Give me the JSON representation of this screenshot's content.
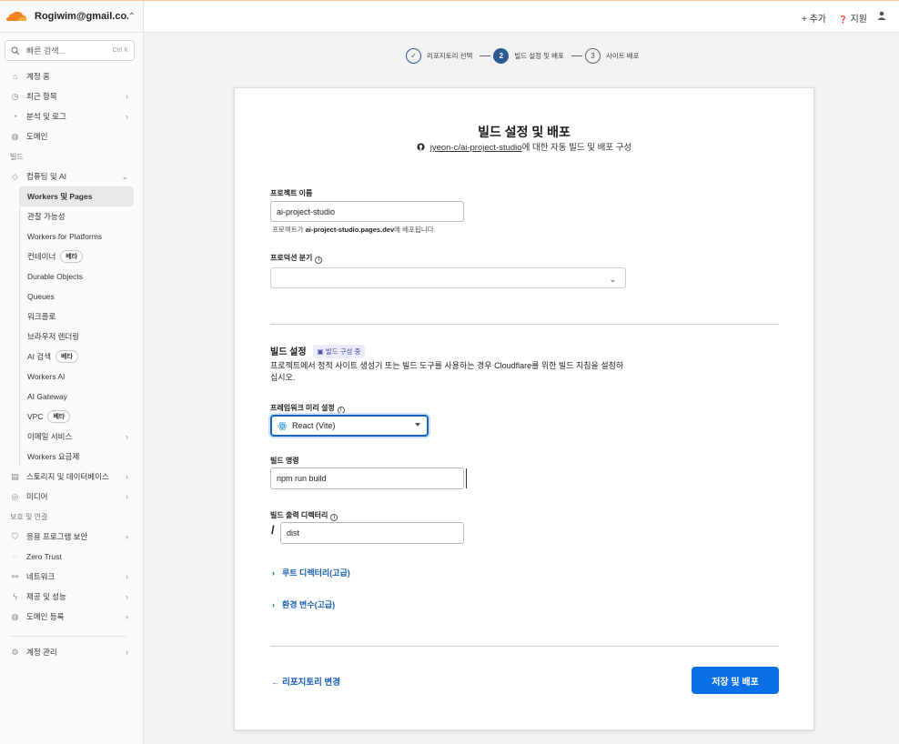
{
  "account": {
    "email": "Rogiwim@gmail.co..."
  },
  "search": {
    "placeholder": "빠른 검색...",
    "shortcut": "Ctrl K"
  },
  "sidebar": {
    "top_items": [
      {
        "label": "계정 홈"
      },
      {
        "label": "최근 항목"
      },
      {
        "label": "분석 및 로그"
      },
      {
        "label": "도메인"
      }
    ],
    "build_section": "빌드",
    "compute_label": "컴퓨팅 및 AI",
    "compute_items": [
      {
        "label": "Workers 및 Pages"
      },
      {
        "label": "관찰 가능성"
      },
      {
        "label": "Workers for Platforms"
      },
      {
        "label": "컨테이너",
        "badge": "베타"
      },
      {
        "label": "Durable Objects"
      },
      {
        "label": "Queues"
      },
      {
        "label": "워크플로"
      },
      {
        "label": "브라우저 렌더링"
      },
      {
        "label": "AI 검색",
        "badge": "베타"
      },
      {
        "label": "Workers AI"
      },
      {
        "label": "AI Gateway"
      },
      {
        "label": "VPC",
        "badge": "베타"
      },
      {
        "label": "이메일 서비스"
      },
      {
        "label": "Workers 요금제"
      }
    ],
    "storage_label": "스토리지 및 데이터베이스",
    "media_label": "미디어",
    "protect_section": "보호 및 연결",
    "protect_items": [
      {
        "label": "응용 프로그램 보안"
      },
      {
        "label": "Zero Trust"
      },
      {
        "label": "네트워크"
      },
      {
        "label": "제공 및 성능"
      },
      {
        "label": "도메인 등록"
      }
    ],
    "account_manage": "계정 관리"
  },
  "topbar": {
    "add": "+ 추가",
    "support": "지원"
  },
  "stepper": {
    "steps": [
      {
        "num": "✓",
        "label": "리포지토리 선택"
      },
      {
        "num": "2",
        "label": "빌드 설정 및 배포"
      },
      {
        "num": "3",
        "label": "사이트 배포"
      }
    ]
  },
  "card": {
    "title": "빌드 설정 및 배포",
    "repo": "jyeon-c/ai-project-studio",
    "subtitle_suffix": "에 대한 자동 빌드 및 배포 구성",
    "project_name_label": "프로젝트 이름",
    "project_name_value": "ai-project-studio",
    "deploy_help_prefix": "프로젝트가 ",
    "deploy_help_domain": "ai-project-studio.pages.dev",
    "deploy_help_suffix": "에 배포됩니다.",
    "branch_label": "프로덕션 분기",
    "branch_value": "",
    "build_settings_title": "빌드 설정",
    "build_settings_badge": "빌드 구성 중",
    "build_settings_desc": "프로젝트에서 정적 사이트 생성기 또는 빌드 도구를 사용하는 경우 Cloudflare를 위한 빌드 지침을 설정하십시오.",
    "framework_label": "프레임워크 미리 설정",
    "framework_value": "React (Vite)",
    "build_cmd_label": "빌드 명령",
    "build_cmd_value": "npm run build",
    "output_dir_label": "빌드 출력 디렉터리",
    "output_prefix": "/",
    "output_dir_value": "dist",
    "root_dir": "루트 디렉터리(고급)",
    "env_vars": "환경 변수(고급)",
    "back_link": "← 리포지토리 변경",
    "save_button": "저장 및 배포"
  },
  "colors": {
    "primary": "#0b6fe8",
    "link": "#1a5fb4",
    "step": "#2c5a92",
    "cf_orange": "#f48120"
  }
}
